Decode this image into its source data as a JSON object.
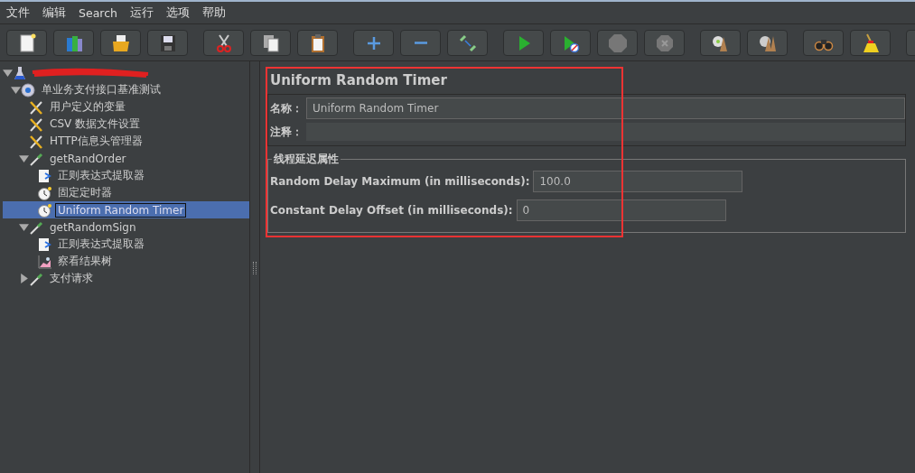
{
  "menu": [
    {
      "label": "文件"
    },
    {
      "label": "编辑"
    },
    {
      "label": "Search"
    },
    {
      "label": "运行"
    },
    {
      "label": "选项"
    },
    {
      "label": "帮助"
    }
  ],
  "toolbar": [
    {
      "buttons": [
        {
          "kind": "new"
        },
        {
          "kind": "templates"
        },
        {
          "kind": "open"
        },
        {
          "kind": "save"
        }
      ]
    },
    {
      "buttons": [
        {
          "kind": "cut"
        },
        {
          "kind": "copy"
        },
        {
          "kind": "paste"
        }
      ]
    },
    {
      "buttons": [
        {
          "kind": "expand"
        },
        {
          "kind": "collapse"
        },
        {
          "kind": "toggle"
        }
      ]
    },
    {
      "buttons": [
        {
          "kind": "start"
        },
        {
          "kind": "start_no_pause"
        },
        {
          "kind": "stop"
        },
        {
          "kind": "shutdown"
        }
      ]
    },
    {
      "buttons": [
        {
          "kind": "clear"
        },
        {
          "kind": "clear_all"
        }
      ]
    },
    {
      "buttons": [
        {
          "kind": "search"
        },
        {
          "kind": "reset"
        }
      ]
    },
    {
      "buttons": [
        {
          "kind": "partial"
        }
      ]
    }
  ],
  "tree": [
    {
      "kind": "plan",
      "redacted": true,
      "expanded": true,
      "selected": false,
      "children": [
        {
          "kind": "thread_group",
          "label": "单业务支付接口基准测试",
          "expanded": true,
          "selected": false,
          "children": [
            {
              "kind": "config",
              "label": "用户定义的变量",
              "selected": false
            },
            {
              "kind": "config",
              "label": "CSV 数据文件设置",
              "selected": false
            },
            {
              "kind": "config",
              "label": "HTTP信息头管理器",
              "selected": false
            },
            {
              "kind": "sampler",
              "label": "getRandOrder",
              "expanded": true,
              "selected": false,
              "children": [
                {
                  "kind": "extractor",
                  "label": "正则表达式提取器",
                  "selected": false
                },
                {
                  "kind": "timer",
                  "label": "固定定时器",
                  "selected": false
                },
                {
                  "kind": "timer",
                  "label": "Uniform Random Timer",
                  "selected": true
                }
              ]
            },
            {
              "kind": "sampler",
              "label": "getRandomSign",
              "expanded": true,
              "selected": false,
              "children": [
                {
                  "kind": "extractor",
                  "label": "正则表达式提取器",
                  "selected": false
                },
                {
                  "kind": "listener",
                  "label": "察看结果树",
                  "selected": false
                }
              ]
            },
            {
              "kind": "sampler",
              "label": "支付请求",
              "expanded": false,
              "selected": false
            }
          ]
        }
      ]
    }
  ],
  "panel": {
    "title": "Uniform Random Timer",
    "name": {
      "label": "名称：",
      "value": "Uniform Random Timer"
    },
    "comment": {
      "label": "注释："
    },
    "group": {
      "title": "线程延迟属性",
      "fields": [
        {
          "label": "Random Delay Maximum (in milliseconds):",
          "value": "100.0"
        },
        {
          "label": "Constant Delay Offset (in milliseconds):",
          "value": "0"
        }
      ]
    }
  }
}
